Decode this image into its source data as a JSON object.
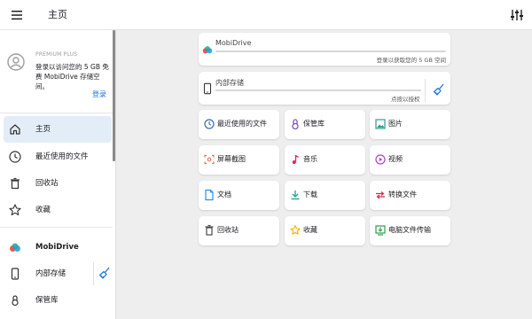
{
  "app": {
    "title": "主页"
  },
  "icons": {
    "menu": "menu-icon",
    "tune": "tune-icon",
    "avatar": "account-circle-icon",
    "home": "home-icon",
    "recent": "clock-icon",
    "trash": "trash-icon",
    "star": "star-icon",
    "cloud": "cloud-icon",
    "phone": "phone-icon",
    "vault": "lock-icon",
    "broom": "broom-icon"
  },
  "colors": {
    "accent": "#1a73e8",
    "active_bg": "#e3edf7",
    "cloud_red": "#ef5350",
    "cloud_blue": "#42a5f5",
    "cloud_green": "#26a69a"
  },
  "drawer": {
    "plan_label": "PREMIUM PLUS",
    "account_text": "登录以访问您的 5 GB 免费 MobiDrive 存储空间。",
    "login_label": "登录",
    "items": [
      {
        "label": "主页",
        "active": true
      },
      {
        "label": "最近使用的文件"
      },
      {
        "label": "回收站"
      },
      {
        "label": "收藏"
      },
      {
        "label": "MobiDrive"
      },
      {
        "label": "内部存储"
      },
      {
        "label": "保管库"
      }
    ]
  },
  "storage": [
    {
      "name": "MobiDrive",
      "note": "登录以获取您的 5 GB 空间"
    },
    {
      "name": "内部存储",
      "note": "点按以授权"
    }
  ],
  "tiles": [
    {
      "label": "最近使用的文件",
      "icon": "clock-icon",
      "color": "#3f6ab3"
    },
    {
      "label": "保管库",
      "icon": "lock-icon",
      "color": "#7e57c2"
    },
    {
      "label": "图片",
      "icon": "image-icon",
      "color": "#2e9e8f"
    },
    {
      "label": "屏幕截图",
      "icon": "screenshot-icon",
      "color": "#e57360"
    },
    {
      "label": "音乐",
      "icon": "music-note-icon",
      "color": "#e91e63"
    },
    {
      "label": "视频",
      "icon": "play-circle-icon",
      "color": "#ab47bc"
    },
    {
      "label": "文档",
      "icon": "document-icon",
      "color": "#2d8ee8"
    },
    {
      "label": "下载",
      "icon": "download-icon",
      "color": "#26a69a"
    },
    {
      "label": "转换文件",
      "icon": "convert-icon",
      "color": "#d32f5a"
    },
    {
      "label": "回收站",
      "icon": "trash-icon",
      "color": "#4a4a4a"
    },
    {
      "label": "收藏",
      "icon": "star-icon",
      "color": "#f5b400"
    },
    {
      "label": "电脑文件传输",
      "icon": "pc-transfer-icon",
      "color": "#2e9e4f"
    }
  ]
}
